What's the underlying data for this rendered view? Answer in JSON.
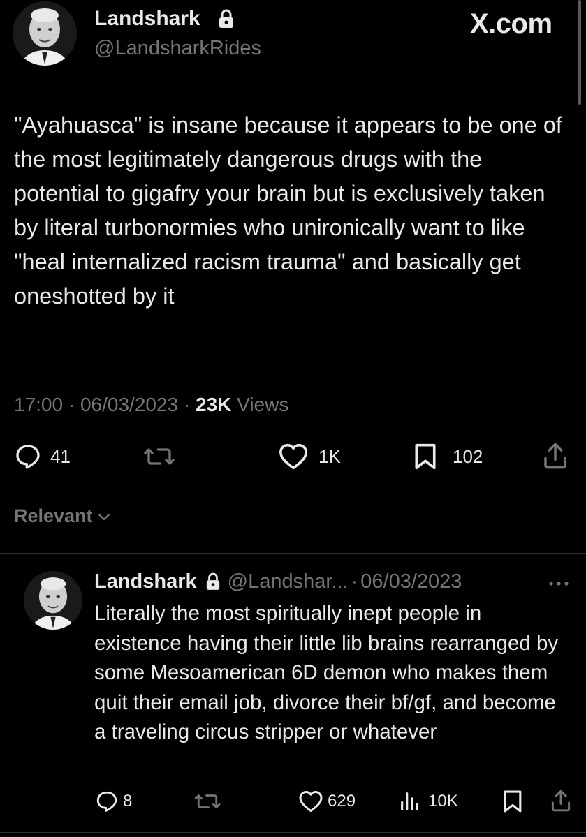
{
  "watermark": "X.com",
  "main_tweet": {
    "name": "Landshark",
    "handle": "@LandsharkRides",
    "text": "\"Ayahuasca\" is insane because it appears to be one of the most legitimately dangerous drugs with the potential to gigafry your brain but is exclusively taken by literal turbonormies who unironically want to like \"heal internalized racism trauma\" and basically get oneshotted by it",
    "time": "17:00",
    "date": "06/03/2023",
    "views_count": "23K",
    "views_label": "Views",
    "replies": "41",
    "likes": "1K",
    "bookmarks": "102"
  },
  "sort": {
    "label": "Relevant"
  },
  "reply_tweet": {
    "name": "Landshark",
    "handle": "@Landshar...",
    "date": "06/03/2023",
    "text": "Literally the most spiritually inept people in existence having their little lib brains rearranged by some Mesoamerican 6D demon who makes them quit their email job, divorce their bf/gf, and become a traveling circus stripper or whatever",
    "replies": "8",
    "likes": "629",
    "views": "10K"
  },
  "colors": {
    "background": "#000000",
    "text": "#e7e9ea",
    "secondary": "#71767b",
    "divider": "#2f3336"
  },
  "icons": [
    "lock-icon",
    "reply-icon",
    "retweet-icon",
    "like-icon",
    "bookmark-icon",
    "share-icon",
    "views-icon",
    "more-icon",
    "chevron-down-icon"
  ]
}
